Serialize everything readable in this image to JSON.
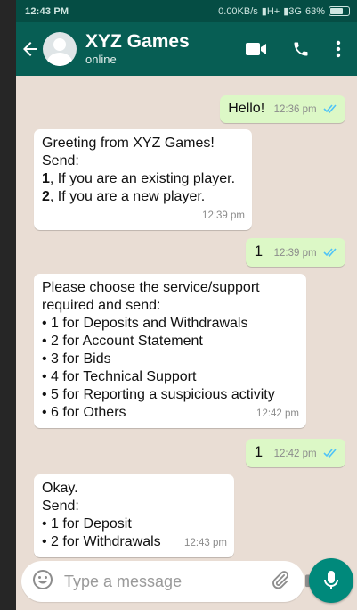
{
  "status_bar": {
    "time": "12:43 PM",
    "network": "0.00KB/s",
    "signal1": "H+",
    "signal2": "3G",
    "battery": "63%"
  },
  "header": {
    "contact_name": "XYZ Games",
    "contact_status": "online"
  },
  "messages": [
    {
      "dir": "out",
      "lines": [
        "Hello!"
      ],
      "time": "12:36 pm",
      "read": true
    },
    {
      "dir": "in",
      "lines": [
        "Greeting from XYZ Games!",
        "Send:",
        "1",
        ", If you are an existing player.",
        "2",
        ", If you are a new player."
      ],
      "time": "12:39 pm"
    },
    {
      "dir": "out",
      "lines": [
        "1"
      ],
      "time": "12:39 pm",
      "read": true
    },
    {
      "dir": "in",
      "lines": [
        "Please choose the service/support",
        "required and send:",
        "• 1 for Deposits and Withdrawals",
        "• 2 for Account Statement",
        "• 3 for Bids",
        "• 4 for Technical Support",
        "• 5 for Reporting a suspicious activity",
        "• 6 for Others"
      ],
      "time": "12:42 pm"
    },
    {
      "dir": "out",
      "lines": [
        "1"
      ],
      "time": "12:42 pm",
      "read": true
    },
    {
      "dir": "in",
      "lines": [
        "Okay.",
        "Send:",
        "• 1 for Deposit",
        "• 2 for Withdrawals"
      ],
      "time": "12:43 pm"
    }
  ],
  "composer": {
    "placeholder": "Type a message"
  },
  "colors": {
    "header": "#075e54",
    "status_bar": "#054d44",
    "chat_bg": "#e9ddd4",
    "outgoing": "#dcf8c6",
    "incoming": "#ffffff",
    "read_ticks": "#4fc3f7",
    "mic_button": "#00897b"
  },
  "icons": [
    "back-arrow-icon",
    "video-call-icon",
    "voice-call-icon",
    "more-options-icon",
    "emoji-icon",
    "attach-icon",
    "camera-icon",
    "mic-icon",
    "double-check-icon"
  ]
}
